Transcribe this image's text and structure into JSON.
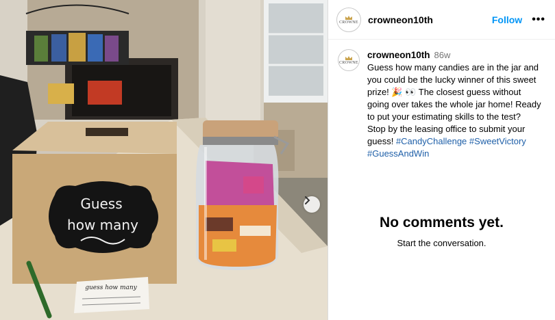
{
  "post": {
    "account": {
      "username": "crowneon10th",
      "avatar_brand": "CROWNE",
      "follow_label": "Follow",
      "more_label": "•••"
    },
    "caption": {
      "username": "crowneon10th",
      "time": "86w",
      "text": "Guess how many candies are in the jar and you could be the lucky winner of this sweet prize! 🎉 👀  The closest guess without going over takes the whole jar home! Ready to put your estimating skills to the test? Stop by the leasing office to submit your guess!",
      "hashtags": [
        "#CandyChallenge",
        "#SweetVictory",
        "#GuessAndWin"
      ]
    },
    "comments": {
      "empty_title": "No comments yet.",
      "empty_subtitle": "Start the conversation."
    },
    "photo": {
      "box_sign": [
        "Guess",
        "how many"
      ],
      "card_text": "guess how many"
    }
  }
}
